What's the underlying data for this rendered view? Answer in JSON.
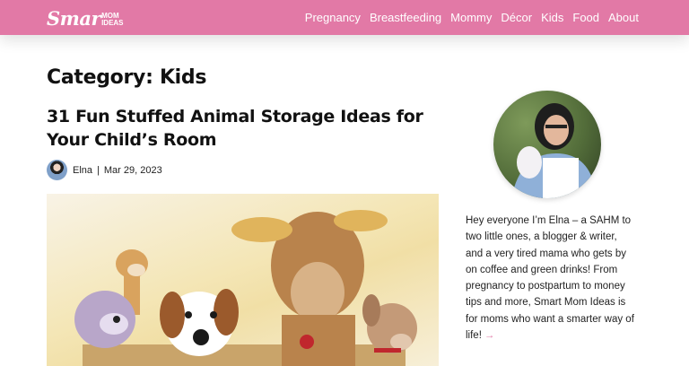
{
  "logo": {
    "script": "Smar",
    "small_top": "MOM",
    "small_bottom": "IDEAS"
  },
  "nav": {
    "items": [
      "Pregnancy",
      "Breastfeeding",
      "Mommy",
      "Décor",
      "Kids",
      "Food",
      "About"
    ]
  },
  "archive": {
    "heading": "Category: Kids"
  },
  "post": {
    "title": "31 Fun Stuffed Animal Storage Ideas for Your Child’s Room",
    "author": "Elna",
    "separator": "|",
    "date": "Mar 29, 2023"
  },
  "sidebar": {
    "bio": "Hey everyone I’m Elna – a SAHM to two little ones, a blogger & writer, and a very tired mama who gets by on coffee and green drinks! From pregnancy to postpartum to money tips and more, Smart Mom Ideas is for moms who want a smarter way of life!",
    "more_arrow": "→"
  },
  "colors": {
    "brand_pink": "#e279a6",
    "text": "#111111",
    "background": "#ffffff"
  },
  "icons": {
    "avatar": "author-avatar",
    "arrow": "right-arrow-icon"
  }
}
